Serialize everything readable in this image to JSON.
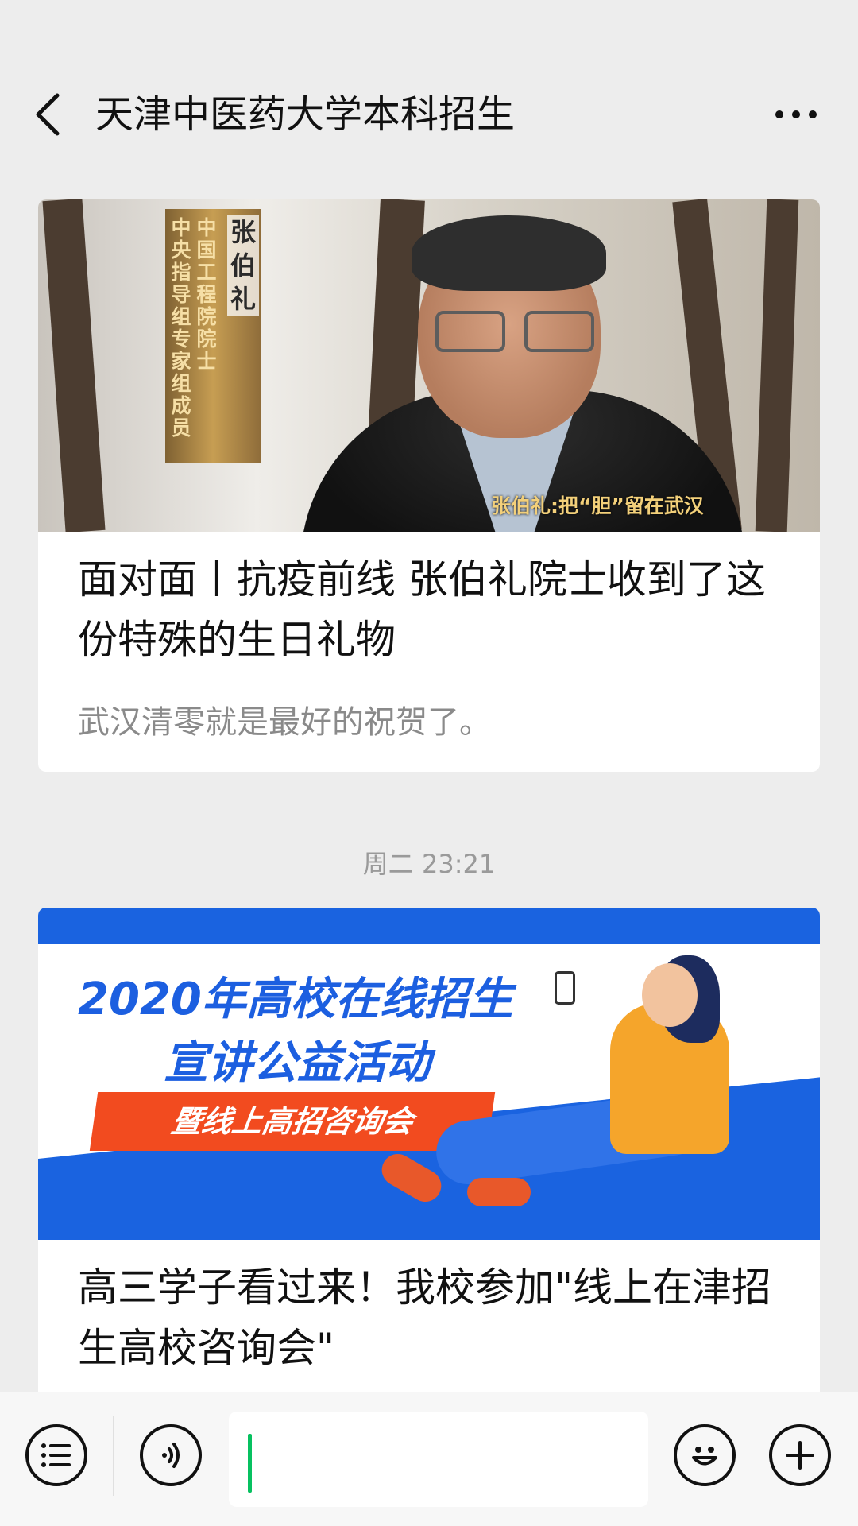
{
  "header": {
    "title": "天津中医药大学本科招生",
    "back_icon": "chevron-left-icon",
    "more_icon": "more-dots-icon"
  },
  "articles": [
    {
      "title": "面对面丨抗疫前线 张伯礼院士收到了这份特殊的生日礼物",
      "digest": "武汉清零就是最好的祝贺了。",
      "cover": {
        "name_caption": "张伯礼",
        "role_caption_1": "中国工程院院士",
        "role_caption_2": "中央指导组专家组成员",
        "lower_caption": "张伯礼:把“胆”留在武汉"
      }
    },
    {
      "title": "高三学子看过来！我校参加\"线上在津招生高校咨询会\"",
      "cover": {
        "line1": "2020年高校在线招生",
        "line2": "宣讲公益活动",
        "banner": "暨线上高招咨询会"
      }
    }
  ],
  "timestamp": "周二 23:21",
  "bottom_bar": {
    "menu_icon": "list-menu-icon",
    "voice_icon": "voice-icon",
    "emoji_icon": "emoji-icon",
    "plus_icon": "plus-icon",
    "input_value": ""
  },
  "colors": {
    "background": "#ededed",
    "card": "#ffffff",
    "caret": "#07c160",
    "banner_blue": "#1a63e0",
    "banner_orange": "#f24b1f"
  }
}
